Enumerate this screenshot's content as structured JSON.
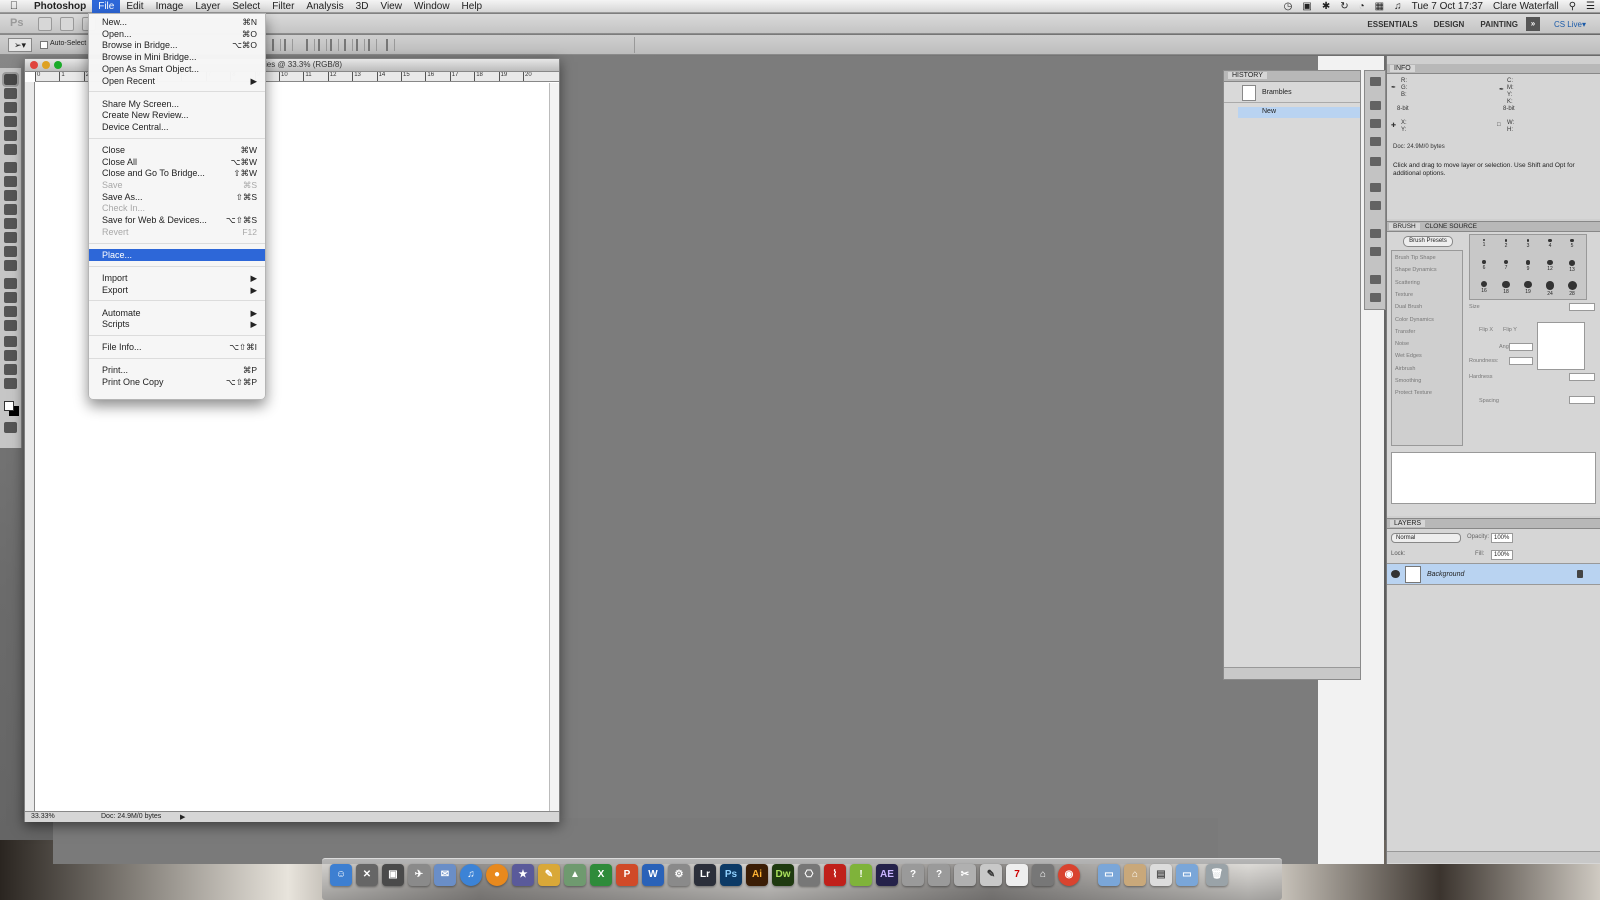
{
  "menubar": {
    "app_name": "Photoshop",
    "items": [
      "File",
      "Edit",
      "Image",
      "Layer",
      "Select",
      "Filter",
      "Analysis",
      "3D",
      "View",
      "Window",
      "Help"
    ],
    "clock": "Tue 7 Oct  17:37",
    "user": "Clare Waterfall"
  },
  "appbar": {
    "logo": "Ps",
    "workspaces": [
      "ESSENTIALS",
      "DESIGN",
      "PAINTING"
    ],
    "more": "»",
    "cs_live": "CS Live▾"
  },
  "options": {
    "auto_select": "Auto-Select"
  },
  "document": {
    "title": "ies @ 33.3% (RGB/8)",
    "ruler_ticks": [
      "0",
      "1",
      "2",
      "3",
      "4",
      "5",
      "6",
      "7",
      "8",
      "9",
      "10",
      "11",
      "12",
      "13",
      "14",
      "15",
      "16",
      "17",
      "18",
      "19",
      "20"
    ],
    "zoom": "33.33%",
    "doc_size": "Doc: 24.9M/0 bytes"
  },
  "file_menu": {
    "groups": [
      [
        {
          "label": "New...",
          "shortcut": "⌘N"
        },
        {
          "label": "Open...",
          "shortcut": "⌘O"
        },
        {
          "label": "Browse in Bridge...",
          "shortcut": "⌥⌘O"
        },
        {
          "label": "Browse in Mini Bridge...",
          "shortcut": ""
        },
        {
          "label": "Open As Smart Object...",
          "shortcut": ""
        },
        {
          "label": "Open Recent",
          "shortcut": "▶"
        }
      ],
      [
        {
          "label": "Share My Screen...",
          "shortcut": ""
        },
        {
          "label": "Create New Review...",
          "shortcut": ""
        },
        {
          "label": "Device Central...",
          "shortcut": ""
        }
      ],
      [
        {
          "label": "Close",
          "shortcut": "⌘W"
        },
        {
          "label": "Close All",
          "shortcut": "⌥⌘W"
        },
        {
          "label": "Close and Go To Bridge...",
          "shortcut": "⇧⌘W"
        },
        {
          "label": "Save",
          "shortcut": "⌘S",
          "disabled": true
        },
        {
          "label": "Save As...",
          "shortcut": "⇧⌘S"
        },
        {
          "label": "Check In...",
          "shortcut": "",
          "disabled": true
        },
        {
          "label": "Save for Web & Devices...",
          "shortcut": "⌥⇧⌘S"
        },
        {
          "label": "Revert",
          "shortcut": "F12",
          "disabled": true
        }
      ],
      [
        {
          "label": "Place...",
          "shortcut": "",
          "highlighted": true
        }
      ],
      [
        {
          "label": "Import",
          "shortcut": "▶"
        },
        {
          "label": "Export",
          "shortcut": "▶"
        }
      ],
      [
        {
          "label": "Automate",
          "shortcut": "▶"
        },
        {
          "label": "Scripts",
          "shortcut": "▶"
        }
      ],
      [
        {
          "label": "File Info...",
          "shortcut": "⌥⇧⌘I"
        }
      ],
      [
        {
          "label": "Print...",
          "shortcut": "⌘P"
        },
        {
          "label": "Print One Copy",
          "shortcut": "⌥⇧⌘P"
        }
      ]
    ]
  },
  "history": {
    "title": "HISTORY",
    "snapshot": "Brambles",
    "state": "New"
  },
  "info": {
    "title": "INFO",
    "left_channels": [
      "R:",
      "G:",
      "B:"
    ],
    "right_channels": [
      "C:",
      "M:",
      "Y:",
      "K:"
    ],
    "bit_left": "8-bit",
    "bit_right": "8-bit",
    "xy": [
      "X:",
      "Y:"
    ],
    "wh": [
      "W:",
      "H:"
    ],
    "doc": "Doc: 24.9M/0 bytes",
    "hint": "Click and drag to move layer or selection.  Use Shift and Opt for additional options."
  },
  "brush": {
    "tabs": [
      "BRUSH",
      "CLONE SOURCE"
    ],
    "presets_button": "Brush Presets",
    "options": [
      "Brush Tip Shape",
      "Shape Dynamics",
      "Scattering",
      "Texture",
      "Dual Brush",
      "Color Dynamics",
      "Transfer",
      "Noise",
      "Wet Edges",
      "Airbrush",
      "Smoothing",
      "Protect Texture"
    ],
    "tip_sizes": [
      "1",
      "3",
      "5",
      "9",
      "13",
      "19",
      "5",
      "9",
      "13",
      "17",
      "21",
      "27",
      "35",
      "45",
      "65",
      "100",
      "200",
      "300",
      "9",
      "13",
      "19",
      "17",
      "45",
      "65",
      "100",
      "200",
      "300",
      "14",
      "24",
      "27"
    ],
    "sizes_row1": [
      "1",
      "2",
      "3",
      "4",
      "5"
    ],
    "sizes_row2": [
      "6",
      "7",
      "9",
      "12",
      "13"
    ],
    "sizes_row3": [
      "16",
      "18",
      "19",
      "24",
      "28"
    ],
    "size_label": "Size",
    "flip_x": "Flip X",
    "flip_y": "Flip Y",
    "angle_label": "Angle:",
    "roundness_label": "Roundness:",
    "hardness_label": "Hardness",
    "spacing_label": "Spacing"
  },
  "layers": {
    "title": "LAYERS",
    "blend_mode": "Normal",
    "opacity_label": "Opacity:",
    "opacity": "100%",
    "lock_label": "Lock:",
    "fill_label": "Fill:",
    "fill": "100%",
    "layer_name": "Background"
  },
  "dock": {
    "apps": [
      "Finder",
      "Dashboard",
      "Photo Booth",
      "Launchpad",
      "Mail",
      "iTunes",
      "Firefox",
      "iMovie",
      "Pages",
      "Preview",
      "Excel",
      "PowerPoint",
      "Word",
      "Photos",
      "Lr",
      "Ps",
      "Ai",
      "Dw",
      "Screenshot",
      "Acrobat",
      "Notes",
      "Ae",
      "Help",
      "Help",
      "Script",
      "TextEdit",
      "Calendar",
      "Graduation",
      "Chrome",
      "Applications",
      "Home",
      "Documents",
      "Downloads",
      "Trash"
    ],
    "labels": {
      "lr": "Lr",
      "ps": "Ps",
      "ai": "Ai",
      "dw": "Dw",
      "ae": "AE",
      "w": "W",
      "x": "X",
      "p": "P",
      "cal": "7"
    }
  }
}
